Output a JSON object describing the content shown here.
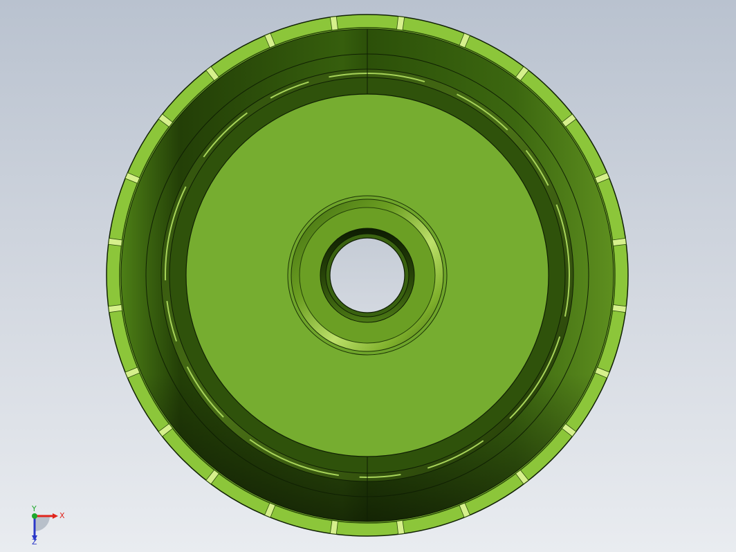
{
  "viewport": {
    "part": "wheel-hub",
    "colors": {
      "background_top": "#b9c2cf",
      "background_bottom": "#e9ecf0",
      "part_light": "#76ad30",
      "part_rim": "#8cc63a",
      "part_dark": "#1f3a06",
      "part_mid": "#3f6b12",
      "edge": "#102004",
      "highlight": "#d6f08c"
    }
  },
  "triad": {
    "x_label": "X",
    "y_label": "Y",
    "z_label": "Z",
    "x_color": "#e0241c",
    "y_color": "#1fa82c",
    "z_color": "#2a37c8"
  }
}
